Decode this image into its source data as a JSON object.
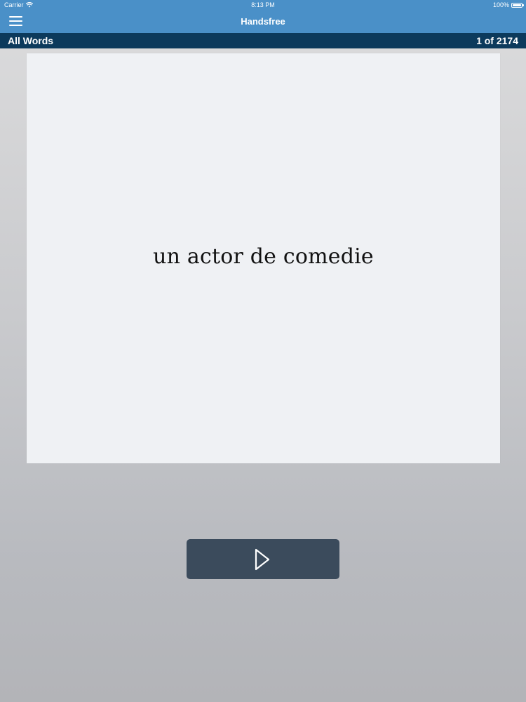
{
  "status_bar": {
    "carrier": "Carrier",
    "time": "8:13 PM",
    "battery": "100%"
  },
  "header": {
    "title": "Handsfree",
    "menu_icon": "hamburger-menu-icon"
  },
  "subheader": {
    "list_name": "All Words",
    "position": "1 of 2174"
  },
  "card": {
    "word": "un actor de comedie"
  },
  "controls": {
    "play_icon": "play-icon"
  },
  "colors": {
    "header_bg": "#4a90c8",
    "subheader_bg": "#0c3a5c",
    "card_bg": "#eff1f4",
    "button_bg": "#3b4b5c"
  }
}
